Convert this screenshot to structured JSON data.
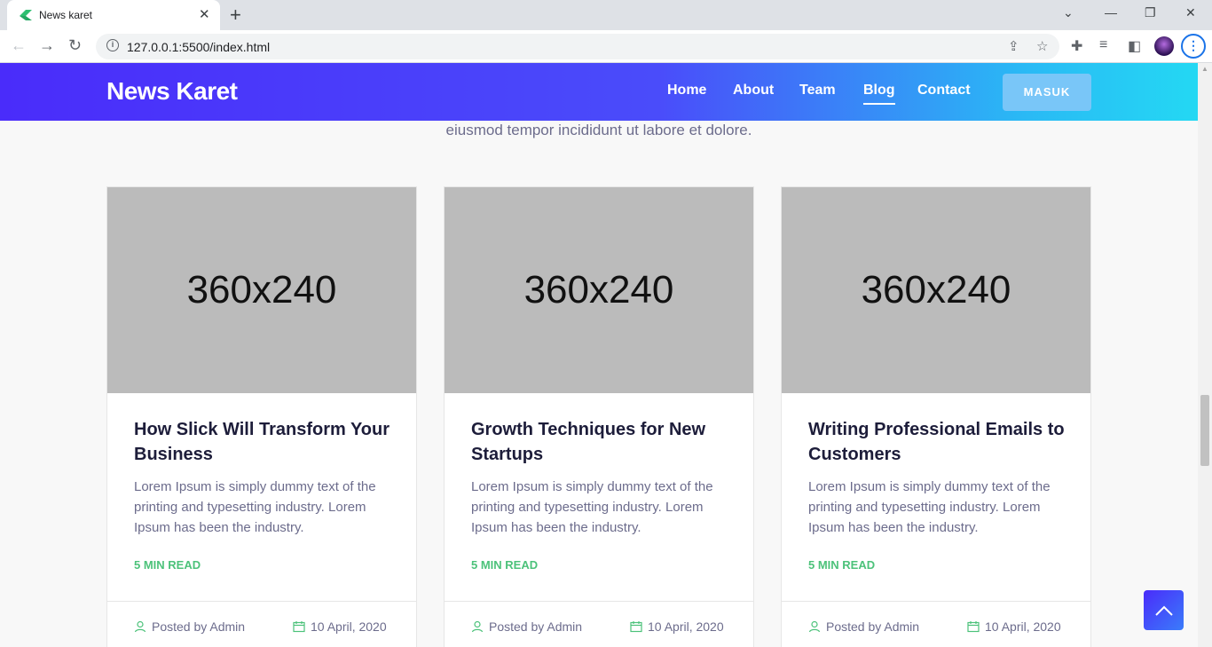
{
  "browser": {
    "tab_title": "News karet",
    "url": "127.0.0.1:5500/index.html"
  },
  "site": {
    "logo": "News Karet",
    "nav": [
      {
        "label": "Home"
      },
      {
        "label": "About"
      },
      {
        "label": "Team"
      },
      {
        "label": "Blog"
      },
      {
        "label": "Contact"
      }
    ],
    "active_nav": "Blog",
    "login_button": "MASUK",
    "intro_text": "eiusmod tempor incididunt ut labore et dolore."
  },
  "posts": [
    {
      "thumb": "360x240",
      "title": "How Slick Will Transform Your Business",
      "excerpt": "Lorem Ipsum is simply dummy text of the printing and typesetting industry. Lorem Ipsum has been the industry.",
      "read_label": "5 MIN READ",
      "author": "Posted by Admin",
      "date": "10 April, 2020"
    },
    {
      "thumb": "360x240",
      "title": "Growth Techniques for New Startups",
      "excerpt": "Lorem Ipsum is simply dummy text of the printing and typesetting industry. Lorem Ipsum has been the industry.",
      "read_label": "5 MIN READ",
      "author": "Posted by Admin",
      "date": "10 April, 2020"
    },
    {
      "thumb": "360x240",
      "title": "Writing Professional Emails to Customers",
      "excerpt": "Lorem Ipsum is simply dummy text of the printing and typesetting industry. Lorem Ipsum has been the industry.",
      "read_label": "5 MIN READ",
      "author": "Posted by Admin",
      "date": "10 April, 2020"
    }
  ],
  "icons": {
    "author": "user-icon",
    "date": "calendar-icon",
    "scroll_top": "chevron-up-icon"
  },
  "colors": {
    "header_start": "#4a2cfa",
    "header_end": "#24d8f3",
    "accent_green": "#4cc27a",
    "login_button": "#79c6f8"
  }
}
